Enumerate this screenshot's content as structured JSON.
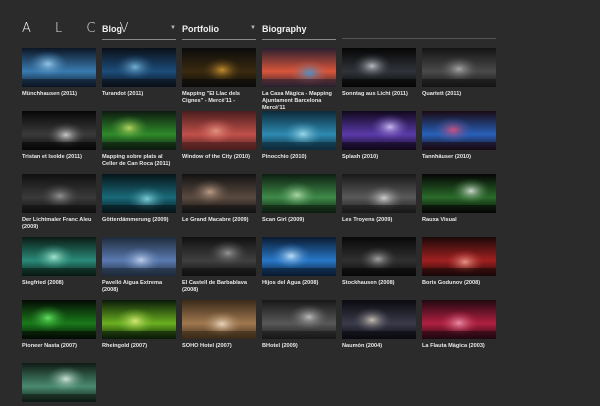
{
  "logo": "A L C V",
  "nav": [
    {
      "label": "Blog",
      "arrow": "▼"
    },
    {
      "label": "Portfolio",
      "arrow": "▼"
    },
    {
      "label": "Biography"
    }
  ],
  "items": [
    {
      "caption": "Münchhausen (2011)",
      "colors": [
        "#0c1624",
        "#3a7bb0",
        "#9fd2f2"
      ]
    },
    {
      "caption": "Turandot (2011)",
      "colors": [
        "#0a1018",
        "#1d4d7a",
        "#7dbde0"
      ]
    },
    {
      "caption": "Mapping \"El Llac dels Cignes\" - Mercè'11 -",
      "colors": [
        "#0b0b0b",
        "#3a2a10",
        "#d69a30"
      ]
    },
    {
      "caption": "La Casa Màgica - Mapping Ajuntament Barcelona Mercè'11",
      "colors": [
        "#2a2030",
        "#d8553a",
        "#3c9ad8"
      ]
    },
    {
      "caption": "Sonntag aus Licht (2011)",
      "colors": [
        "#050505",
        "#30343a",
        "#c8ccd0"
      ]
    },
    {
      "caption": "Quartett (2011)",
      "colors": [
        "#141414",
        "#4a4a4a",
        "#b0b0b0"
      ]
    },
    {
      "caption": "Tristan et Isolde (2011)",
      "colors": [
        "#070707",
        "#3a3a3a",
        "#d9d9d9"
      ]
    },
    {
      "caption": "Mapping sobre plats al Celler de Can Roca (2011)",
      "colors": [
        "#0d1a10",
        "#2f8a2a",
        "#c8e06a"
      ]
    },
    {
      "caption": "Window of the City (2010)",
      "colors": [
        "#4a1e1e",
        "#c0504a",
        "#e89a88"
      ]
    },
    {
      "caption": "Pinocchio (2010)",
      "colors": [
        "#0c2a3a",
        "#2e8ab0",
        "#a8e0f0"
      ]
    },
    {
      "caption": "Splash (2010)",
      "colors": [
        "#10081c",
        "#5a3aa8",
        "#d8c8ff"
      ]
    },
    {
      "caption": "Tannhäuser (2010)",
      "colors": [
        "#1a0a14",
        "#2860b8",
        "#e05078"
      ]
    },
    {
      "caption": "Der Lichtmaler Franc Aleu (2009)",
      "colors": [
        "#101010",
        "#3a3a3a",
        "#9a9a9a"
      ]
    },
    {
      "caption": "Götterdämmerung (2009)",
      "colors": [
        "#061418",
        "#1a6a7a",
        "#8ad8e0"
      ]
    },
    {
      "caption": "Le Grand Macabre (2009)",
      "colors": [
        "#121212",
        "#5a4a40",
        "#c8a890"
      ]
    },
    {
      "caption": "Scan Girl (2009)",
      "colors": [
        "#0d1d10",
        "#3e8a48",
        "#b8e0b0"
      ]
    },
    {
      "caption": "Les Troyens (2009)",
      "colors": [
        "#181818",
        "#5a5a5a",
        "#dadada"
      ]
    },
    {
      "caption": "Rauxa Visual",
      "colors": [
        "#050505",
        "#2a6a2a",
        "#e0e8e0"
      ]
    },
    {
      "caption": "Siegfried (2008)",
      "colors": [
        "#0a1a14",
        "#2a8a78",
        "#b0f0d8"
      ]
    },
    {
      "caption": "Pavelló Aigua Extrema (2008)",
      "colors": [
        "#1e2a3a",
        "#5a7ab0",
        "#c8d8f0"
      ]
    },
    {
      "caption": "El Castell de Barbablava (2008)",
      "colors": [
        "#101010",
        "#404040",
        "#a0a0a0"
      ]
    },
    {
      "caption": "Hijos del Agua (2008)",
      "colors": [
        "#0a1a30",
        "#2878c8",
        "#d0ecff"
      ]
    },
    {
      "caption": "Stockhausen (2008)",
      "colors": [
        "#080808",
        "#303030",
        "#b0b0b0"
      ]
    },
    {
      "caption": "Boris Godunov (2008)",
      "colors": [
        "#1a0808",
        "#a02020",
        "#f0a090"
      ]
    },
    {
      "caption": "Pioneer Nasta (2007)",
      "colors": [
        "#040a04",
        "#1a7a1a",
        "#6af06a"
      ]
    },
    {
      "caption": "Rheingold (2007)",
      "colors": [
        "#0a1a08",
        "#6ab020",
        "#e0f080"
      ]
    },
    {
      "caption": "SOHO Hotel (2007)",
      "colors": [
        "#3a2a18",
        "#a07850",
        "#f0e0c8"
      ]
    },
    {
      "caption": "BHotel (2009)",
      "colors": [
        "#181818",
        "#585858",
        "#c8c8c8"
      ]
    },
    {
      "caption": "Naumón (2004)",
      "colors": [
        "#0a0a10",
        "#3a3a4a",
        "#d8d0c0"
      ]
    },
    {
      "caption": "La Flauta Màgica (2003)",
      "colors": [
        "#200810",
        "#b02040",
        "#f098b0"
      ]
    },
    {
      "caption": "",
      "colors": [
        "#0e1a14",
        "#4a8a70",
        "#e0f0e8"
      ]
    }
  ]
}
